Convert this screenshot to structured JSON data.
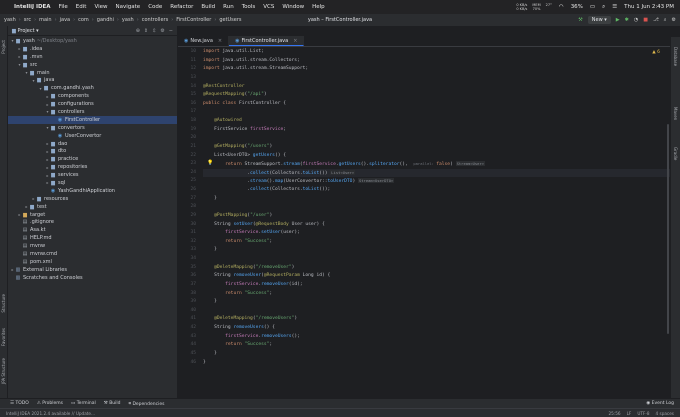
{
  "menubar": {
    "app": "IntelliJ IDEA",
    "items": [
      "File",
      "Edit",
      "View",
      "Navigate",
      "Code",
      "Refactor",
      "Build",
      "Run",
      "Tools",
      "VCS",
      "Window",
      "Help"
    ],
    "tray": [
      {
        "top": "0 KB/s",
        "bottom": "0 KB/s"
      },
      {
        "top": "MEM",
        "bottom": "70%"
      },
      {
        "top": "",
        "bottom": "27°"
      }
    ],
    "battery": "36%",
    "clock": "Thu 1 Jun  2:43 PM"
  },
  "titlebar": {
    "title": "yash – FirstController.java",
    "breadcrumb": [
      "yash",
      "src",
      "main",
      "java",
      "com",
      "gandhi",
      "yash",
      "controllers",
      "FirstController",
      "getUsers"
    ],
    "run_config": "New"
  },
  "left_tools": [
    "Project",
    "Structure",
    "Favorites",
    "JPA Structure"
  ],
  "project_panel": {
    "title": "Project",
    "tree": [
      {
        "d": 0,
        "a": "▾",
        "i": "folder",
        "t": "yash",
        "dim": "~/Desktop/yash"
      },
      {
        "d": 1,
        "a": "▸",
        "i": "folder",
        "t": ".idea"
      },
      {
        "d": 1,
        "a": "▸",
        "i": "folder",
        "t": ".mvn"
      },
      {
        "d": 1,
        "a": "▾",
        "i": "folder",
        "t": "src"
      },
      {
        "d": 2,
        "a": "▾",
        "i": "folder",
        "t": "main"
      },
      {
        "d": 3,
        "a": "▾",
        "i": "folder",
        "t": "java"
      },
      {
        "d": 4,
        "a": "▾",
        "i": "folder",
        "t": "com.gandhi.yash"
      },
      {
        "d": 5,
        "a": "▸",
        "i": "folder",
        "t": "components"
      },
      {
        "d": 5,
        "a": "▸",
        "i": "folder",
        "t": "configurations"
      },
      {
        "d": 5,
        "a": "▾",
        "i": "folder",
        "t": "controllers"
      },
      {
        "d": 6,
        "a": "",
        "i": "class",
        "t": "FirstController",
        "sel": true
      },
      {
        "d": 5,
        "a": "▾",
        "i": "folder",
        "t": "convertors"
      },
      {
        "d": 6,
        "a": "",
        "i": "class",
        "t": "UserConvertor"
      },
      {
        "d": 5,
        "a": "▸",
        "i": "folder",
        "t": "dao"
      },
      {
        "d": 5,
        "a": "▸",
        "i": "folder",
        "t": "dto"
      },
      {
        "d": 5,
        "a": "▸",
        "i": "folder",
        "t": "practice"
      },
      {
        "d": 5,
        "a": "▸",
        "i": "folder",
        "t": "repositories"
      },
      {
        "d": 5,
        "a": "▸",
        "i": "folder",
        "t": "services"
      },
      {
        "d": 5,
        "a": "▸",
        "i": "folder",
        "t": "sql"
      },
      {
        "d": 5,
        "a": "",
        "i": "class",
        "t": "YashGandhiApplication"
      },
      {
        "d": 3,
        "a": "▸",
        "i": "folder",
        "t": "resources"
      },
      {
        "d": 2,
        "a": "▸",
        "i": "folder",
        "t": "test"
      },
      {
        "d": 1,
        "a": "▸",
        "i": "folder-o",
        "t": "target"
      },
      {
        "d": 1,
        "a": "",
        "i": "file",
        "t": ".gitignore"
      },
      {
        "d": 1,
        "a": "",
        "i": "file",
        "t": "Asa.kt"
      },
      {
        "d": 1,
        "a": "",
        "i": "file",
        "t": "HELP.md"
      },
      {
        "d": 1,
        "a": "",
        "i": "file",
        "t": "mvnw"
      },
      {
        "d": 1,
        "a": "",
        "i": "file",
        "t": "mvnw.cmd"
      },
      {
        "d": 1,
        "a": "",
        "i": "file",
        "t": "pom.xml"
      },
      {
        "d": 0,
        "a": "▸",
        "i": "lib",
        "t": "External Libraries"
      },
      {
        "d": 0,
        "a": "",
        "i": "lib",
        "t": "Scratches and Consoles"
      }
    ]
  },
  "tabs": [
    {
      "label": "New.java",
      "active": false
    },
    {
      "label": "FirstController.java",
      "active": true
    }
  ],
  "editor": {
    "warning_badge": "▲ 6",
    "first_line": 10,
    "current_line": 24,
    "lines": [
      [
        [
          "kw",
          "import "
        ],
        [
          "pl",
          "java.util.List;"
        ]
      ],
      [
        [
          "kw",
          "import "
        ],
        [
          "pl",
          "java.util.stream.Collectors;"
        ]
      ],
      [
        [
          "kw",
          "import "
        ],
        [
          "pl",
          "java.util.stream.StreamSupport;"
        ]
      ],
      [],
      [
        [
          "an",
          "@RestController"
        ]
      ],
      [
        [
          "an",
          "@RequestMapping"
        ],
        [
          "pl",
          "("
        ],
        [
          "st",
          "\"/api\""
        ],
        [
          "pl",
          ")"
        ]
      ],
      [
        [
          "kw",
          "public class "
        ],
        [
          "pl",
          "FirstController {"
        ]
      ],
      [],
      [
        [
          "pl",
          "    "
        ],
        [
          "an",
          "@Autowired"
        ]
      ],
      [
        [
          "pl",
          "    FirstService "
        ],
        [
          "fld",
          "firstService"
        ],
        [
          "pl",
          ";"
        ]
      ],
      [],
      [
        [
          "pl",
          "    "
        ],
        [
          "an",
          "@GetMapping"
        ],
        [
          "pl",
          "("
        ],
        [
          "st",
          "\"/users\""
        ],
        [
          "pl",
          ")"
        ]
      ],
      [
        [
          "pl",
          "    List<UserDTO> "
        ],
        [
          "fn",
          "getUsers"
        ],
        [
          "pl",
          "() {"
        ]
      ],
      [
        [
          "pl",
          "        "
        ],
        [
          "kw",
          "return "
        ],
        [
          "pl",
          "StreamSupport."
        ],
        [
          "fn",
          "stream"
        ],
        [
          "pl",
          "("
        ],
        [
          "fld",
          "firstService"
        ],
        [
          "pl",
          "."
        ],
        [
          "fn",
          "getUsers"
        ],
        [
          "pl",
          "()."
        ],
        [
          "fn",
          "spliterator"
        ],
        [
          "pl",
          "(),  "
        ],
        [
          "hint",
          "parallel: "
        ],
        [
          "kw",
          "false"
        ],
        [
          "pl",
          ") "
        ],
        [
          "hintbox",
          "Stream<User>"
        ]
      ],
      [
        [
          "pl",
          "                ."
        ],
        [
          "fn",
          "collect"
        ],
        [
          "pl",
          "(Collectors."
        ],
        [
          "fn",
          "toList"
        ],
        [
          "pl",
          "()) "
        ],
        [
          "hintbox",
          "List<User>"
        ]
      ],
      [
        [
          "pl",
          "                ."
        ],
        [
          "fn",
          "stream"
        ],
        [
          "pl",
          "()."
        ],
        [
          "fn",
          "map"
        ],
        [
          "pl",
          "(UserConvertor::"
        ],
        [
          "fn",
          "toUserDTO"
        ],
        [
          "pl",
          ") "
        ],
        [
          "hintbox",
          "Stream<UserDTO>"
        ]
      ],
      [
        [
          "pl",
          "                ."
        ],
        [
          "fn",
          "collect"
        ],
        [
          "pl",
          "(Collectors."
        ],
        [
          "fn",
          "toList"
        ],
        [
          "pl",
          "());"
        ]
      ],
      [
        [
          "pl",
          "    }"
        ]
      ],
      [],
      [
        [
          "pl",
          "    "
        ],
        [
          "an",
          "@PostMapping"
        ],
        [
          "pl",
          "("
        ],
        [
          "st",
          "\"/user\""
        ],
        [
          "pl",
          ")"
        ]
      ],
      [
        [
          "pl",
          "    String "
        ],
        [
          "fn",
          "setUser"
        ],
        [
          "pl",
          "("
        ],
        [
          "an",
          "@RequestBody "
        ],
        [
          "pl",
          "User user) {"
        ]
      ],
      [
        [
          "pl",
          "        "
        ],
        [
          "fld",
          "firstService"
        ],
        [
          "pl",
          "."
        ],
        [
          "fn",
          "setUser"
        ],
        [
          "pl",
          "(user);"
        ]
      ],
      [
        [
          "pl",
          "        "
        ],
        [
          "kw",
          "return "
        ],
        [
          "st",
          "\"Success\""
        ],
        [
          "pl",
          ";"
        ]
      ],
      [
        [
          "pl",
          "    }"
        ]
      ],
      [],
      [
        [
          "pl",
          "    "
        ],
        [
          "an",
          "@DeleteMapping"
        ],
        [
          "pl",
          "("
        ],
        [
          "st",
          "\"/removeUser\""
        ],
        [
          "pl",
          ")"
        ]
      ],
      [
        [
          "pl",
          "    String "
        ],
        [
          "fn",
          "removeUser"
        ],
        [
          "pl",
          "("
        ],
        [
          "an",
          "@RequestParam "
        ],
        [
          "pl",
          "Long id) {"
        ]
      ],
      [
        [
          "pl",
          "        "
        ],
        [
          "fld",
          "firstService"
        ],
        [
          "pl",
          "."
        ],
        [
          "fn",
          "removeUser"
        ],
        [
          "pl",
          "(id);"
        ]
      ],
      [
        [
          "pl",
          "        "
        ],
        [
          "kw",
          "return "
        ],
        [
          "st",
          "\"Success\""
        ],
        [
          "pl",
          ";"
        ]
      ],
      [
        [
          "pl",
          "    }"
        ]
      ],
      [],
      [
        [
          "pl",
          "    "
        ],
        [
          "an",
          "@DeleteMapping"
        ],
        [
          "pl",
          "("
        ],
        [
          "st",
          "\"/removeUsers\""
        ],
        [
          "pl",
          ")"
        ]
      ],
      [
        [
          "pl",
          "    String "
        ],
        [
          "fn",
          "removeUsers"
        ],
        [
          "pl",
          "() {"
        ]
      ],
      [
        [
          "pl",
          "        "
        ],
        [
          "fld",
          "firstService"
        ],
        [
          "pl",
          "."
        ],
        [
          "fn",
          "removeUsers"
        ],
        [
          "pl",
          "();"
        ]
      ],
      [
        [
          "pl",
          "        "
        ],
        [
          "kw",
          "return "
        ],
        [
          "st",
          "\"Success\""
        ],
        [
          "pl",
          ";"
        ]
      ],
      [
        [
          "pl",
          "    }"
        ]
      ],
      [
        [
          "pl",
          "}"
        ]
      ]
    ]
  },
  "right_tools": [
    "Database",
    "Maven",
    "Gradle"
  ],
  "bottom_tools": [
    "TODO",
    "Problems",
    "Terminal",
    "Build",
    "Dependencies"
  ],
  "bottom_right": "Event Log",
  "status": {
    "left": "IntelliJ IDEA 2021.2.4 available // Update...",
    "right": [
      "25:56",
      "LF",
      "UTF-8",
      "4 spaces"
    ]
  }
}
